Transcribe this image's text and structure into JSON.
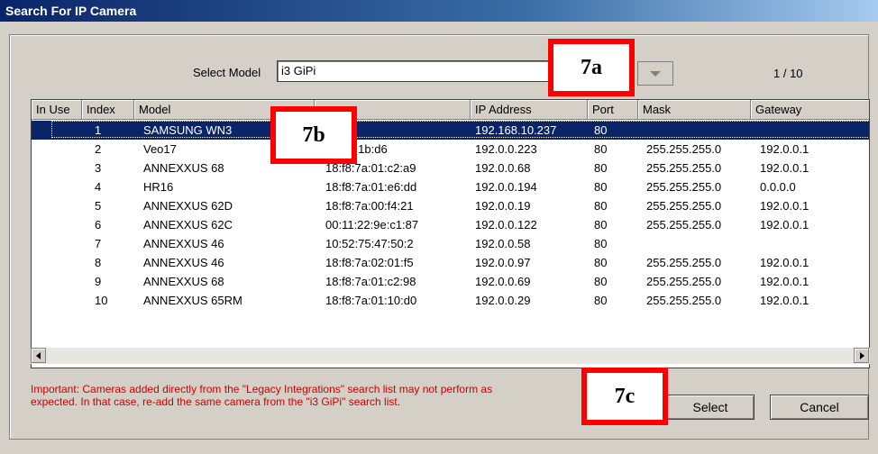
{
  "window": {
    "title": "Search For IP Camera"
  },
  "model_select": {
    "label": "Select Model",
    "value": "i3 GiPi"
  },
  "page_indicator": "1 / 10",
  "table": {
    "columns": [
      "In Use",
      "Index",
      "Model",
      "",
      "IP Address",
      "Port",
      "Mask",
      "Gateway"
    ],
    "rows": [
      {
        "in_use": "",
        "index": "1",
        "model": "SAMSUNG WN3",
        "mac": "",
        "ip": "192.168.10.237",
        "port": "80",
        "mask": "",
        "gateway": "",
        "selected": true
      },
      {
        "in_use": "",
        "index": "2",
        "model": "Veo17",
        "mac": "7a:02:1b:d6",
        "ip": "192.0.0.223",
        "port": "80",
        "mask": "255.255.255.0",
        "gateway": "192.0.0.1"
      },
      {
        "in_use": "",
        "index": "3",
        "model": "ANNEXXUS 68",
        "mac": "18:f8:7a:01:c2:a9",
        "ip": "192.0.0.68",
        "port": "80",
        "mask": "255.255.255.0",
        "gateway": "192.0.0.1"
      },
      {
        "in_use": "",
        "index": "4",
        "model": "HR16",
        "mac": "18:f8:7a:01:e6:dd",
        "ip": "192.0.0.194",
        "port": "80",
        "mask": "255.255.255.0",
        "gateway": "0.0.0.0"
      },
      {
        "in_use": "",
        "index": "5",
        "model": "ANNEXXUS 62D",
        "mac": "18:f8:7a:00:f4:21",
        "ip": "192.0.0.19",
        "port": "80",
        "mask": "255.255.255.0",
        "gateway": "192.0.0.1"
      },
      {
        "in_use": "",
        "index": "6",
        "model": "ANNEXXUS 62C",
        "mac": "00:11:22:9e:c1:87",
        "ip": "192.0.0.122",
        "port": "80",
        "mask": "255.255.255.0",
        "gateway": "192.0.0.1"
      },
      {
        "in_use": "",
        "index": "7",
        "model": "ANNEXXUS 46",
        "mac": "10:52:75:47:50:2",
        "ip": "192.0.0.58",
        "port": "80",
        "mask": "",
        "gateway": ""
      },
      {
        "in_use": "",
        "index": "8",
        "model": "ANNEXXUS 46",
        "mac": "18:f8:7a:02:01:f5",
        "ip": "192.0.0.97",
        "port": "80",
        "mask": "255.255.255.0",
        "gateway": "192.0.0.1"
      },
      {
        "in_use": "",
        "index": "9",
        "model": "ANNEXXUS 68",
        "mac": "18:f8:7a:01:c2:98",
        "ip": "192.0.0.69",
        "port": "80",
        "mask": "255.255.255.0",
        "gateway": "192.0.0.1"
      },
      {
        "in_use": "",
        "index": "10",
        "model": "ANNEXXUS 65RM",
        "mac": "18:f8:7a:01:10:d0",
        "ip": "192.0.0.29",
        "port": "80",
        "mask": "255.255.255.0",
        "gateway": "192.0.0.1"
      }
    ]
  },
  "warning": "Important: Cameras added directly from the \"Legacy Integrations\" search list may not perform as expected. In that case, re-add the same camera from the \"i3 GiPi\" search list.",
  "buttons": {
    "select": "Select",
    "cancel": "Cancel"
  },
  "callouts": {
    "a": "7a",
    "b": "7b",
    "c": "7c"
  },
  "icons": [
    "dropdown-arrow-icon",
    "scroll-left-icon",
    "scroll-right-icon"
  ],
  "colors": {
    "title_bar": "#0a246a",
    "selection": "#0a246a",
    "warning_text": "#cc0000",
    "callout_border": "#ff0000"
  }
}
